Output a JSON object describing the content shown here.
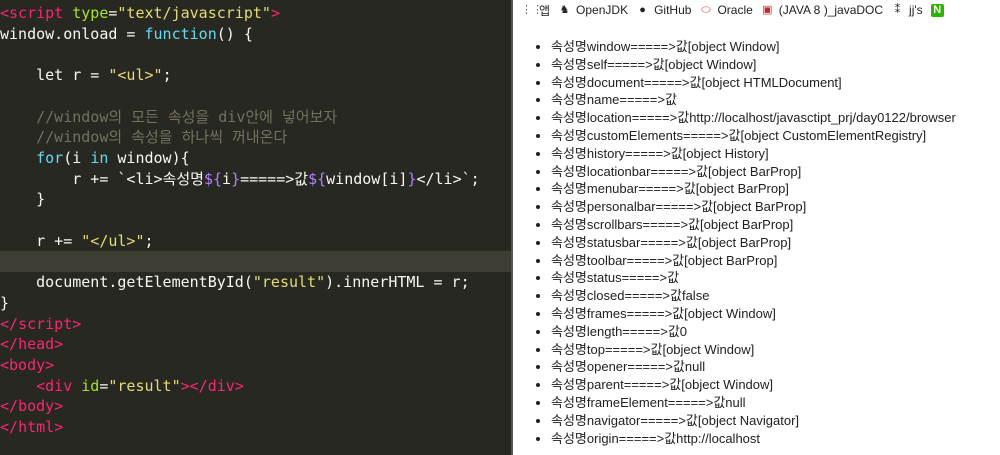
{
  "editor": {
    "lines": [
      [
        [
          "t-tag",
          "<"
        ],
        [
          "t-tag",
          "script"
        ],
        [
          "",
          " "
        ],
        [
          "t-attr",
          "type"
        ],
        [
          "",
          "="
        ],
        [
          "t-str",
          "\"text/javascript\""
        ],
        [
          "t-tag",
          ">"
        ]
      ],
      [
        [
          "",
          "window.onload = "
        ],
        [
          "t-kw",
          "function"
        ],
        [
          "",
          "() {"
        ]
      ],
      [],
      [
        [
          "",
          "    let r = "
        ],
        [
          "t-str",
          "\"<ul>\""
        ],
        [
          "",
          ";"
        ]
      ],
      [],
      [
        [
          "t-cm",
          "    //window의 모든 속성을 div안에 넣어보자"
        ]
      ],
      [
        [
          "t-cm",
          "    //window의 속성을 하나씩 꺼내온다"
        ]
      ],
      [
        [
          "t-kw",
          "    for"
        ],
        [
          "",
          "(i "
        ],
        [
          "t-kw",
          "in"
        ],
        [
          "",
          " window){"
        ]
      ],
      [
        [
          "",
          "        r += `<li>속성명"
        ],
        [
          "t-ph",
          "${"
        ],
        [
          "",
          "i"
        ],
        [
          "t-ph",
          "}"
        ],
        [
          "",
          "=====>값"
        ],
        [
          "t-ph",
          "${"
        ],
        [
          "",
          "window[i]"
        ],
        [
          "t-ph",
          "}"
        ],
        [
          "",
          "</li>`;"
        ]
      ],
      [
        [
          "",
          "    }"
        ]
      ],
      [],
      [
        [
          "",
          "    r += "
        ],
        [
          "t-str",
          "\"</ul>\""
        ],
        [
          "",
          ";"
        ]
      ],
      [],
      [
        [
          "",
          "    document.getElementById("
        ],
        [
          "t-str",
          "\"result\""
        ],
        [
          "",
          ").innerHTML = r;"
        ]
      ],
      [
        [
          "",
          "}"
        ]
      ],
      [
        [
          "t-tag",
          "</"
        ],
        [
          "t-tag",
          "script"
        ],
        [
          "t-tag",
          ">"
        ]
      ],
      [
        [
          "t-tag",
          "</"
        ],
        [
          "t-tag",
          "head"
        ],
        [
          "t-tag",
          ">"
        ]
      ],
      [
        [
          "t-tag",
          "<"
        ],
        [
          "t-tag",
          "body"
        ],
        [
          "t-tag",
          ">"
        ]
      ],
      [
        [
          "",
          "    "
        ],
        [
          "t-tag",
          "<"
        ],
        [
          "t-tag",
          "div"
        ],
        [
          "",
          " "
        ],
        [
          "t-attr",
          "id"
        ],
        [
          "",
          "="
        ],
        [
          "t-str",
          "\"result\""
        ],
        [
          "t-tag",
          "></"
        ],
        [
          "t-tag",
          "div"
        ],
        [
          "t-tag",
          ">"
        ]
      ],
      [
        [
          "t-tag",
          "</"
        ],
        [
          "t-tag",
          "body"
        ],
        [
          "t-tag",
          ">"
        ]
      ],
      [
        [
          "t-tag",
          "</"
        ],
        [
          "t-tag",
          "html"
        ],
        [
          "t-tag",
          ">"
        ]
      ]
    ],
    "current_line": 12
  },
  "bookmarks": [
    {
      "label": "앱",
      "icon": "apps-grid-icon",
      "glyph": "⋮⋮",
      "color": "#5f6368"
    },
    {
      "label": "OpenJDK",
      "icon": "openjdk-duke-icon",
      "glyph": "♞",
      "color": "#202124"
    },
    {
      "label": "GitHub",
      "icon": "github-icon",
      "glyph": "●",
      "color": "#202124"
    },
    {
      "label": "Oracle",
      "icon": "oracle-icon",
      "glyph": "⬭",
      "color": "#e53935"
    },
    {
      "label": "(JAVA 8 )_javaDOC",
      "icon": "bookmark-red-icon",
      "glyph": "▣",
      "color": "#c62828"
    },
    {
      "label": "jj's",
      "icon": "jjs-site-icon",
      "glyph": "⁑",
      "color": "#202124"
    },
    {
      "label": "",
      "icon": "naver-n-icon",
      "glyph": "N",
      "color": "#ffffff",
      "bg": "#2db400"
    }
  ],
  "result_items": [
    "속성명window=====>값[object Window]",
    "속성명self=====>값[object Window]",
    "속성명document=====>값[object HTMLDocument]",
    "속성명name=====>값",
    "속성명location=====>값http://localhost/javasctipt_prj/day0122/browser",
    "속성명customElements=====>값[object CustomElementRegistry]",
    "속성명history=====>값[object History]",
    "속성명locationbar=====>값[object BarProp]",
    "속성명menubar=====>값[object BarProp]",
    "속성명personalbar=====>값[object BarProp]",
    "속성명scrollbars=====>값[object BarProp]",
    "속성명statusbar=====>값[object BarProp]",
    "속성명toolbar=====>값[object BarProp]",
    "속성명status=====>값",
    "속성명closed=====>값false",
    "속성명frames=====>값[object Window]",
    "속성명length=====>값0",
    "속성명top=====>값[object Window]",
    "속성명opener=====>값null",
    "속성명parent=====>값[object Window]",
    "속성명frameElement=====>값null",
    "속성명navigator=====>값[object Navigator]",
    "속성명origin=====>값http://localhost"
  ]
}
